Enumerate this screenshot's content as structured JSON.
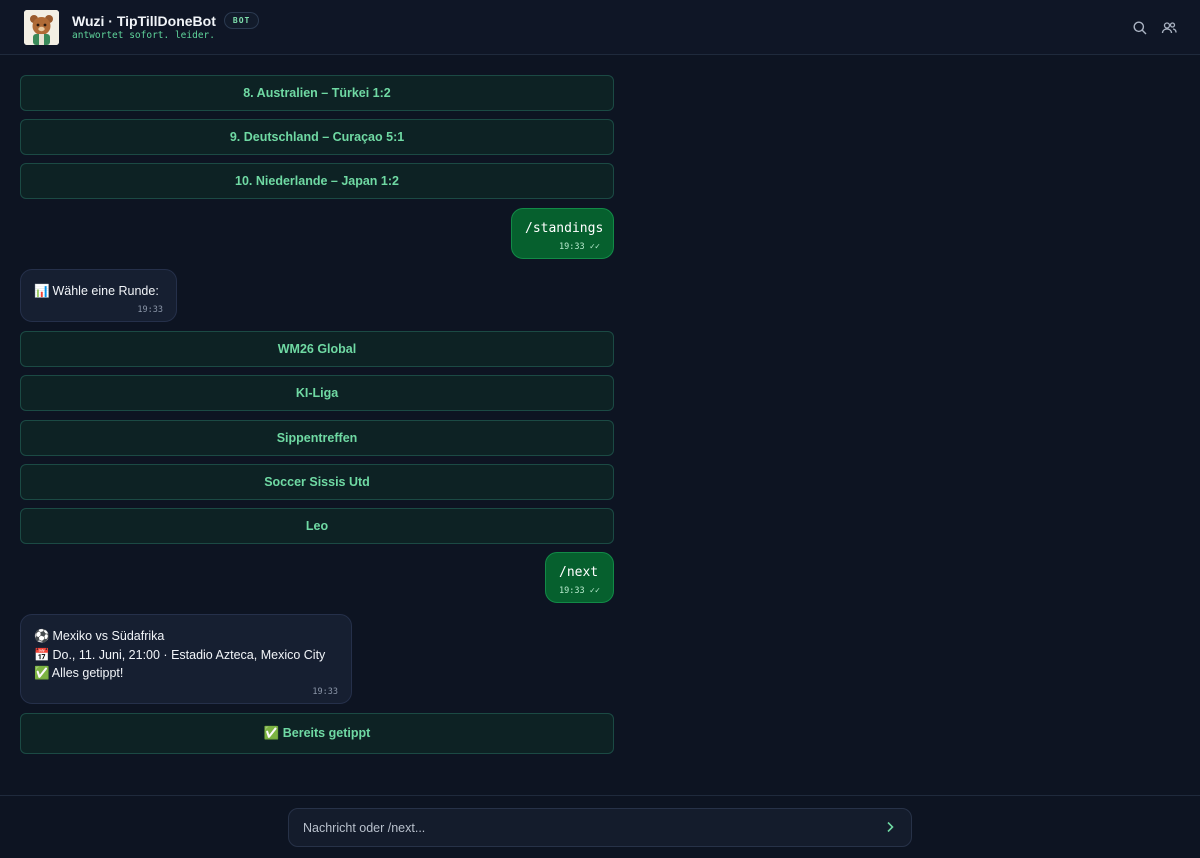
{
  "header": {
    "title": "Wuzi · TipTillDoneBot",
    "badge": "BOT",
    "subtitle": "antwortet sofort. leider."
  },
  "icons": {
    "search": "search-icon",
    "members": "members-icon",
    "send": "chevron-right-icon"
  },
  "colors": {
    "accent": "#6fd9a3",
    "outgoing_bubble": "#06602e",
    "background": "#0d1422"
  },
  "chat": {
    "match_buttons": [
      "8. Australien – Türkei  1:2",
      "9. Deutschland – Curaçao  5:1",
      "10. Niederlande – Japan  1:2"
    ],
    "msg_standings": {
      "text": "/standings",
      "time": "19:33",
      "status": "✓✓"
    },
    "msg_round": {
      "emoji": "📊",
      "text": "Wähle eine Runde:",
      "time": "19:33"
    },
    "round_buttons": [
      "WM26 Global",
      "KI-Liga",
      "Sippentreffen",
      "Soccer Sissis Utd",
      "Leo"
    ],
    "msg_next": {
      "text": "/next",
      "time": "19:33",
      "status": "✓✓"
    },
    "msg_match": {
      "line1_emoji": "⚽",
      "line1": "Mexiko vs Südafrika",
      "line2_emoji": "📅",
      "line2": "Do., 11. Juni, 21:00 · Estadio Azteca, Mexico City",
      "line3_emoji": "✅",
      "line3": "Alles getippt!",
      "time": "19:33"
    },
    "tipped_button": "✅ Bereits getippt"
  },
  "composer": {
    "placeholder": "Nachricht oder /next..."
  }
}
